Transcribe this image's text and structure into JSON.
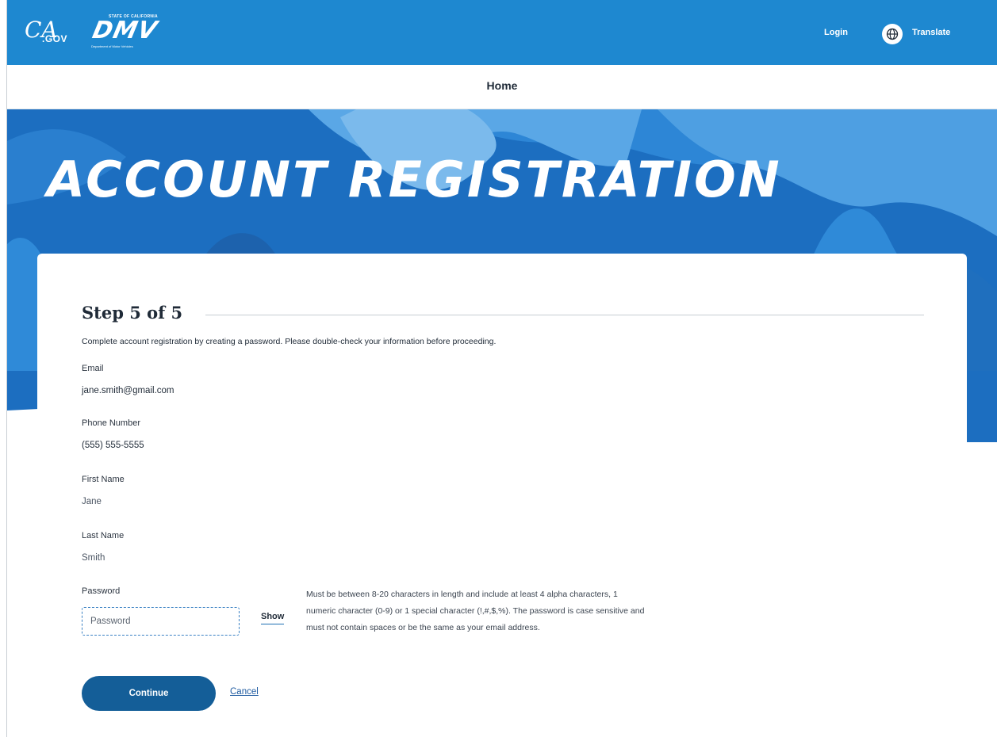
{
  "header": {
    "ca_logo": {
      "ca": "CA",
      "gov": ".GOV"
    },
    "dmv_logo": {
      "state": "STATE OF CALIFORNIA",
      "name": "DMV",
      "department": "Department of Motor Vehicles"
    },
    "login_label": "Login",
    "translate_label": "Translate",
    "translate_icon": "globe-icon",
    "brand_color": "#1e88d0"
  },
  "nav": {
    "home_label": "Home"
  },
  "hero": {
    "title": "ACCOUNT REGISTRATION"
  },
  "form": {
    "step_label": "Step 5 of 5",
    "intro": "Complete account registration by creating a password. Please double-check your information before proceeding.",
    "fields": {
      "email": {
        "label": "Email",
        "value": "jane.smith@gmail.com"
      },
      "phone": {
        "label": "Phone Number",
        "value": "(555) 555-5555"
      },
      "first_name": {
        "label": "First Name",
        "value": "Jane"
      },
      "last_name": {
        "label": "Last Name",
        "value": "Smith"
      }
    },
    "password": {
      "label": "Password",
      "placeholder": "Password",
      "value": "",
      "show_label": "Show",
      "help": "Must be between 8-20 characters in length and include at least 4 alpha characters, 1 numeric character (0-9) or 1 special character (!,#,$,%). The password is case sensitive and must not contain spaces or be the same as your email address."
    },
    "continue_label": "Continue",
    "cancel_label": "Cancel",
    "primary_button_color": "#145e98"
  }
}
